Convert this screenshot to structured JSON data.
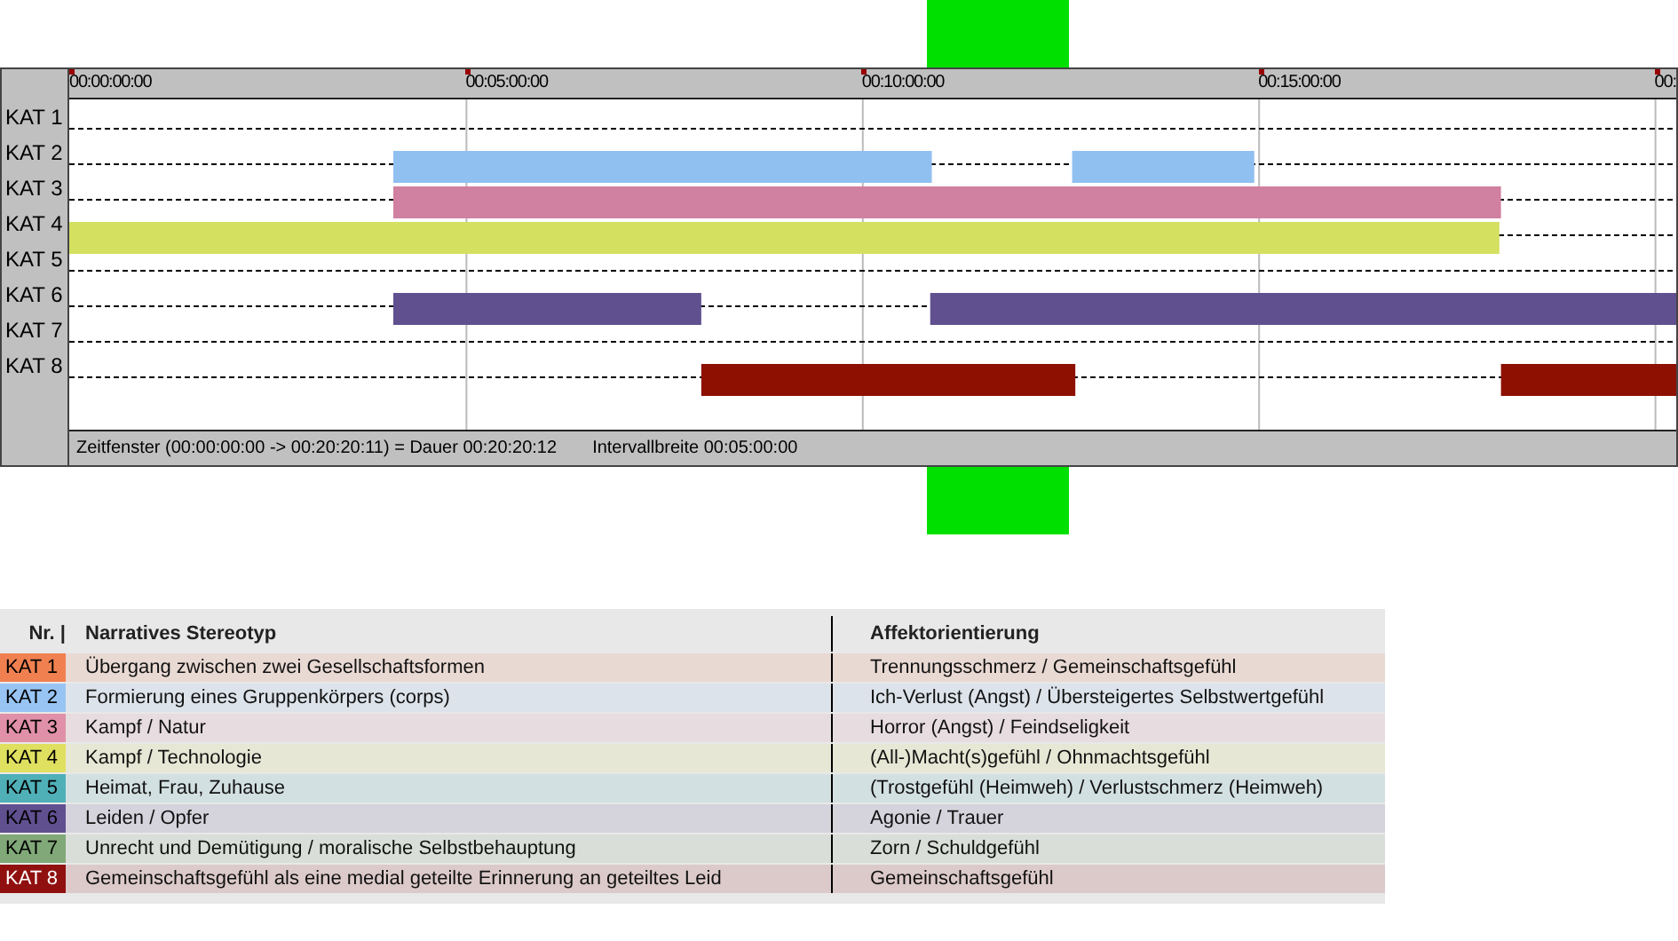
{
  "timeline": {
    "tracks": [
      {
        "label": "KAT 1"
      },
      {
        "label": "KAT 2",
        "color": "#90c0f0"
      },
      {
        "label": "KAT 3",
        "color": "#d080a0"
      },
      {
        "label": "KAT 4",
        "color": "#d4e060"
      },
      {
        "label": "KAT 5"
      },
      {
        "label": "KAT 6",
        "color": "#60508f"
      },
      {
        "label": "KAT 7"
      },
      {
        "label": "KAT 8",
        "color": "#8e1000"
      }
    ],
    "ticks": [
      "00:00:00:00",
      "00:05:00:00",
      "00:10:00:00",
      "00:15:00:00",
      "00:"
    ],
    "status_bar": {
      "window": "Zeitfenster (00:00:00:00 -> 00:20:20:11) = Dauer 00:20:20:12",
      "interval": "Intervallbreite 00:05:00:00"
    }
  },
  "legend": {
    "columns": [
      "Nr. |",
      "Narratives Stereotyp",
      "Affektorientierung"
    ],
    "rows": [
      {
        "nr": "KAT 1",
        "color": "#f08050",
        "stereotype": "Übergang zwischen zwei Gesellschaftsformen",
        "affect": "Trennungsschmerz / Gemeinschaftsgefühl"
      },
      {
        "nr": "KAT 2",
        "color": "#98c4f4",
        "stereotype": "Formierung eines Gruppenkörpers (corps)",
        "affect": "Ich-Verlust (Angst) / Übersteigertes Selbstwertgefühl"
      },
      {
        "nr": "KAT 3",
        "color": "#e090a8",
        "stereotype": "Kampf / Natur",
        "affect": "Horror (Angst) / Feindseligkeit"
      },
      {
        "nr": "KAT 4",
        "color": "#e0e060",
        "stereotype": "Kampf / Technologie",
        "affect": "(All-)Macht(s)gefühl / Ohnmachtsgefühl"
      },
      {
        "nr": "KAT 5",
        "color": "#50b0b8",
        "stereotype": "Heimat, Frau, Zuhause",
        "affect": "(Trostgefühl (Heimweh) / Verlustschmerz (Heimweh)"
      },
      {
        "nr": "KAT 6",
        "color": "#605090",
        "stereotype": "Leiden / Opfer",
        "affect": "Agonie / Trauer"
      },
      {
        "nr": "KAT 7",
        "color": "#80a878",
        "stereotype": "Unrecht und Demütigung / moralische Selbstbehauptung",
        "affect": "Zorn / Schuldgefühl"
      },
      {
        "nr": "KAT 8",
        "color": "#901010",
        "stereotype": "Gemeinschaftsgefühl als eine medial geteilte Erinnerung an geteiltes Leid",
        "affect": "Gemeinschaftsgefühl"
      }
    ]
  }
}
